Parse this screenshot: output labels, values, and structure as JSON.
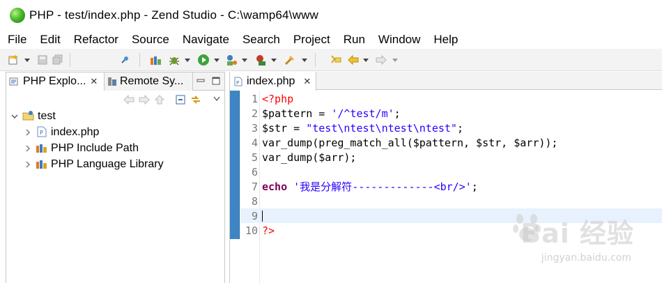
{
  "window": {
    "title": "PHP - test/index.php - Zend Studio - C:\\wamp64\\www",
    "app_icon": "zend-studio-icon"
  },
  "menu": [
    "File",
    "Edit",
    "Refactor",
    "Source",
    "Navigate",
    "Search",
    "Project",
    "Run",
    "Window",
    "Help"
  ],
  "toolbar": {
    "icons": [
      "new-icon",
      "save-icon",
      "save-all-icon",
      "pin-icon",
      "php-lib-icon",
      "debug-icon",
      "run-icon",
      "profile-icon",
      "coverage-icon",
      "tools-icon",
      "bookmark-icon",
      "back-icon",
      "forward-icon"
    ]
  },
  "left_panel": {
    "tabs": [
      {
        "label": "PHP Explo...",
        "active": true
      },
      {
        "label": "Remote Sy...",
        "active": false
      }
    ],
    "tree": {
      "project": "test",
      "children": [
        "index.php",
        "PHP Include Path",
        "PHP Language Library"
      ]
    }
  },
  "editor": {
    "tab_label": "index.php",
    "lines": [
      {
        "n": "1",
        "tokens": [
          {
            "t": "<?php",
            "c": "kw-php"
          }
        ]
      },
      {
        "n": "2",
        "tokens": [
          {
            "t": "$pattern = ",
            "c": "var"
          },
          {
            "t": "'/^test/m'",
            "c": "str"
          },
          {
            "t": ";",
            "c": "var"
          }
        ]
      },
      {
        "n": "3",
        "tokens": [
          {
            "t": "$str = ",
            "c": "var"
          },
          {
            "t": "\"test\\ntest\\ntest\\ntest\"",
            "c": "str"
          },
          {
            "t": ";",
            "c": "var"
          }
        ]
      },
      {
        "n": "4",
        "tokens": [
          {
            "t": "var_dump(preg_match_all($pattern, $str, $arr));",
            "c": "var"
          }
        ]
      },
      {
        "n": "5",
        "tokens": [
          {
            "t": "var_dump($arr);",
            "c": "var"
          }
        ]
      },
      {
        "n": "6",
        "tokens": []
      },
      {
        "n": "7",
        "tokens": [
          {
            "t": "echo",
            "c": "kw"
          },
          {
            "t": " ",
            "c": "var"
          },
          {
            "t": "'我是分解符-------------<br/>'",
            "c": "str"
          },
          {
            "t": ";",
            "c": "var"
          }
        ]
      },
      {
        "n": "8",
        "tokens": []
      },
      {
        "n": "9",
        "tokens": [],
        "current": true
      },
      {
        "n": "10",
        "tokens": [
          {
            "t": "?>",
            "c": "kw-php"
          }
        ]
      }
    ]
  },
  "watermark": {
    "brand": "Bai  经验",
    "url": "jingyan.baidu.com"
  },
  "colors": {
    "accent_gutter": "#3d86c6",
    "php_tag": "#ff0000",
    "keyword": "#7f0055",
    "string": "#2a00ff",
    "current_line": "#e8f2fe"
  }
}
